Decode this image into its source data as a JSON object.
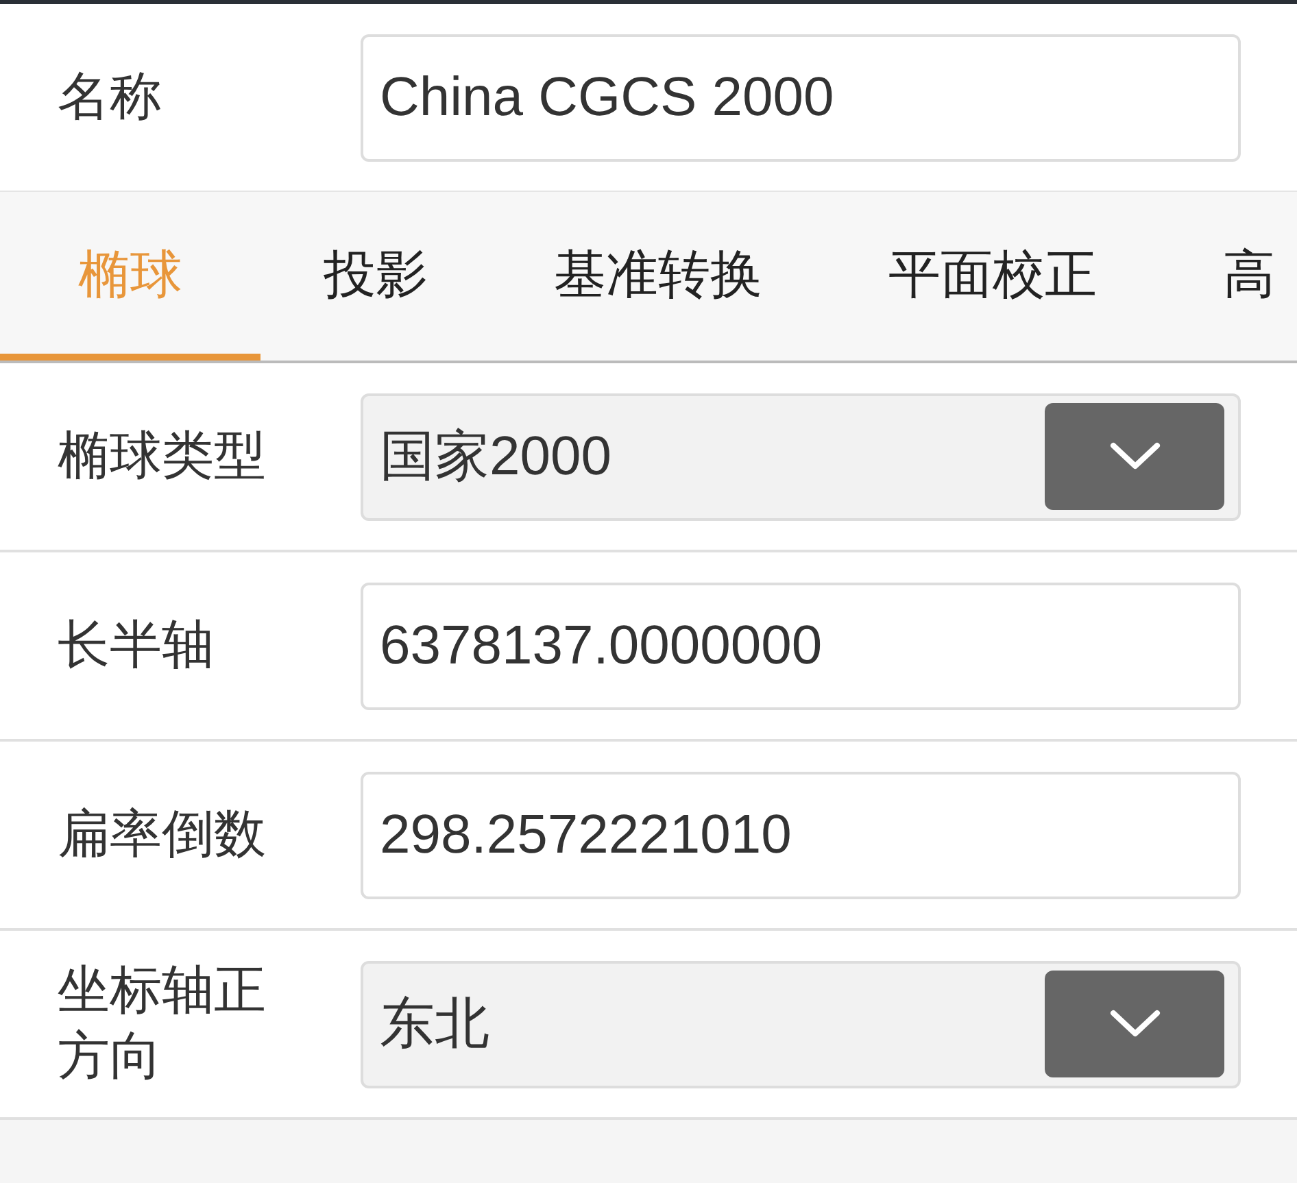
{
  "name_field": {
    "label": "名称",
    "value": "China CGCS 2000"
  },
  "tabs": [
    {
      "label": "椭球",
      "selected": true
    },
    {
      "label": "投影",
      "selected": false
    },
    {
      "label": "基准转换",
      "selected": false
    },
    {
      "label": "平面校正",
      "selected": false
    },
    {
      "label": "高",
      "selected": false
    }
  ],
  "fields": [
    {
      "kind": "select",
      "label": "椭球类型",
      "value": "国家2000"
    },
    {
      "kind": "input",
      "label": "长半轴",
      "value": "6378137.0000000"
    },
    {
      "kind": "input",
      "label": "扁率倒数",
      "value": "298.2572221010"
    },
    {
      "kind": "select",
      "label": "坐标轴正方向",
      "value": "东北"
    }
  ]
}
